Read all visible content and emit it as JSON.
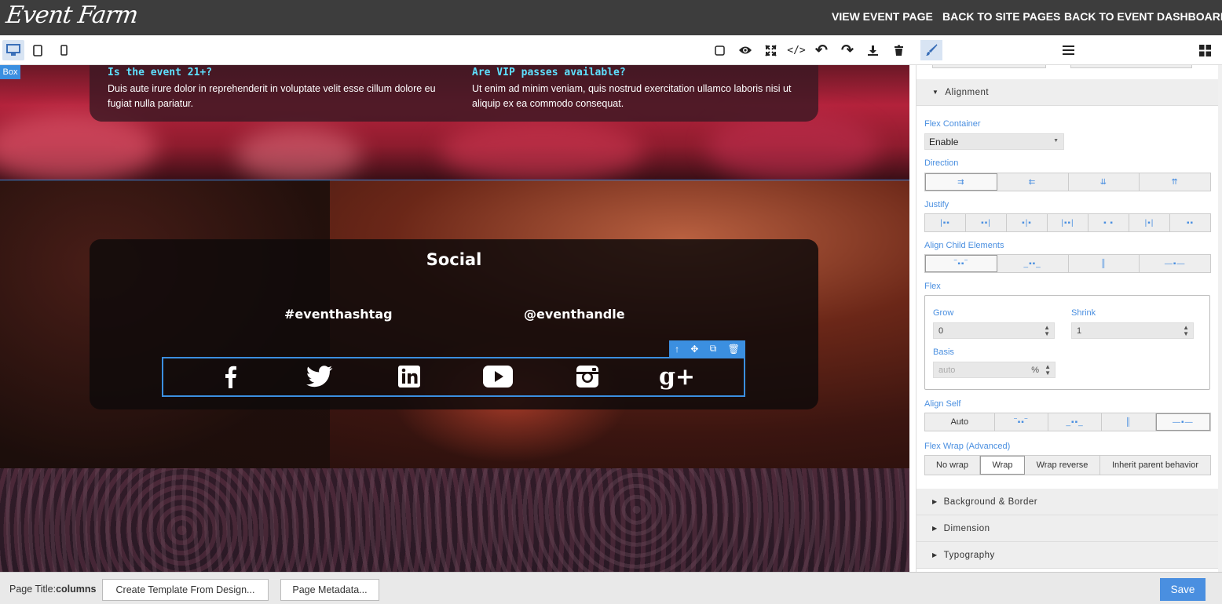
{
  "topbar": {
    "logo": "Event Farm",
    "links": [
      "VIEW EVENT PAGE",
      "BACK TO SITE PAGES",
      "BACK TO EVENT DASHBOARD"
    ]
  },
  "toolbar": {
    "devices": [
      "desktop-icon",
      "tablet-icon",
      "mobile-icon"
    ],
    "actions": [
      "square-icon",
      "eye-icon",
      "fullscreen-icon",
      "code-icon",
      "undo-icon",
      "redo-icon",
      "download-icon",
      "trash-icon"
    ],
    "panels": [
      "paintbrush-icon",
      "layers-icon",
      "blocks-icon"
    ]
  },
  "canvas": {
    "box_badge": "Box",
    "faq": [
      {
        "q": "Is the event 21+?",
        "a": "Duis aute irure dolor in reprehenderit in voluptate velit esse cillum dolore eu fugiat nulla pariatur."
      },
      {
        "q": "Are VIP passes available?",
        "a": "Ut enim ad minim veniam, quis nostrud exercitation ullamco laboris nisi ut aliquip ex ea commodo consequat."
      }
    ],
    "social": {
      "title": "Social",
      "hashtag": "#eventhashtag",
      "handle": "@eventhandle",
      "icons": [
        "facebook-icon",
        "twitter-icon",
        "linkedin-icon",
        "youtube-icon",
        "instagram-icon",
        "google-plus-icon"
      ]
    },
    "selection_tools": [
      "arrow-up-icon",
      "move-icon",
      "copy-icon",
      "trash-icon"
    ]
  },
  "style_panel": {
    "alignment_header": "Alignment",
    "flex_container_label": "Flex Container",
    "flex_container_value": "Enable",
    "direction_label": "Direction",
    "justify_label": "Justify",
    "align_child_label": "Align Child Elements",
    "flex_label": "Flex",
    "grow_label": "Grow",
    "grow_value": "0",
    "shrink_label": "Shrink",
    "shrink_value": "1",
    "basis_label": "Basis",
    "basis_placeholder": "auto",
    "basis_unit": "%",
    "align_self_label": "Align Self",
    "align_self_auto": "Auto",
    "flex_wrap_label": "Flex Wrap (Advanced)",
    "flex_wrap_options": [
      "No wrap",
      "Wrap",
      "Wrap reverse",
      "Inherit parent behavior"
    ],
    "flex_wrap_selected": "Wrap",
    "sections": [
      "Background & Border",
      "Dimension",
      "Typography"
    ]
  },
  "bottombar": {
    "page_title_label": "Page Title:",
    "page_title_value": "columns",
    "create_template": "Create Template From Design...",
    "page_metadata": "Page Metadata...",
    "save": "Save"
  },
  "colors": {
    "accent": "#4a8fe0",
    "topbar": "#3d3d3d",
    "faq_question": "#5ee0ff"
  }
}
